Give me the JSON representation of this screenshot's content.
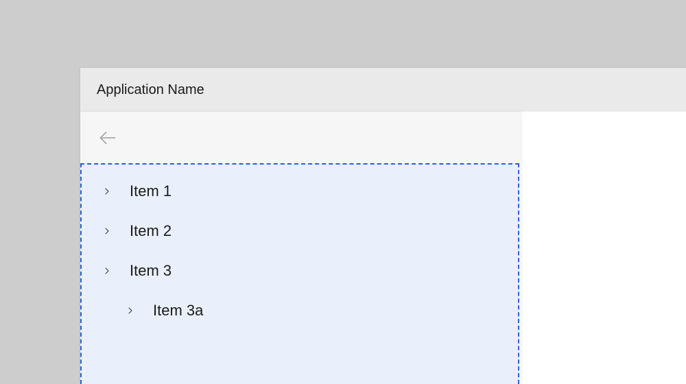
{
  "window": {
    "title": "Application Name"
  },
  "nav": {
    "tree": {
      "items": [
        {
          "label": "Item 1",
          "level": 0
        },
        {
          "label": "Item 2",
          "level": 0
        },
        {
          "label": "Item 3",
          "level": 0
        },
        {
          "label": "Item 3a",
          "level": 1
        }
      ]
    }
  },
  "colors": {
    "selection_border": "#2f5fd8",
    "selection_fill": "#e9f0fb",
    "nav_bg": "#f6f6f6",
    "titlebar_bg": "#eaeaea",
    "page_bg": "#cdcdcd"
  }
}
